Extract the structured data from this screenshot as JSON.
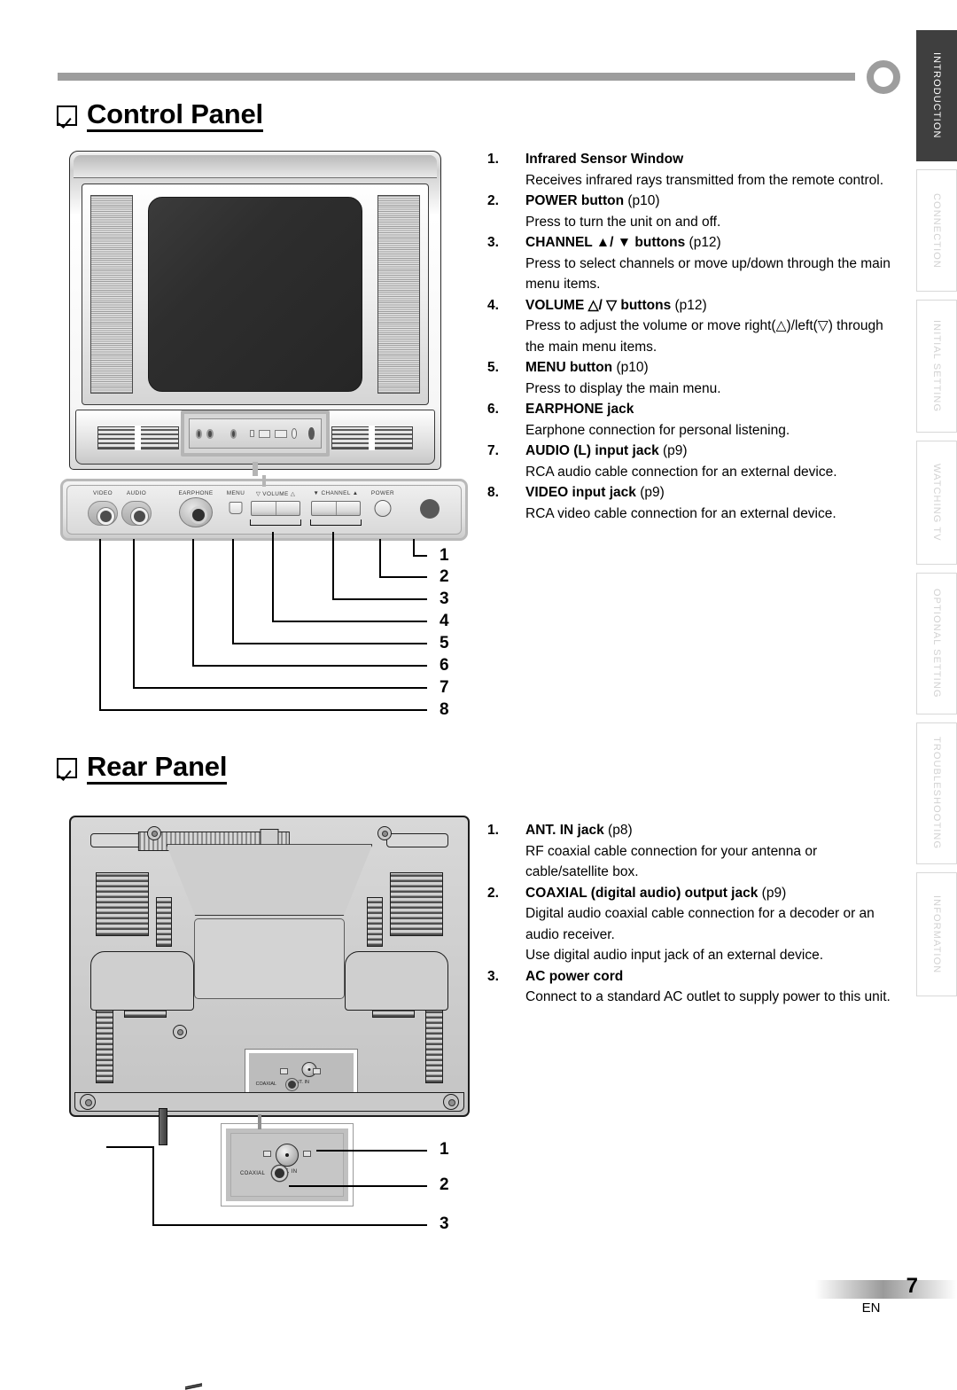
{
  "header": {
    "decor_rule": "horizontal-rule",
    "decor_ring": "ring-marker"
  },
  "sections": {
    "control_panel": {
      "heading": "Control Panel",
      "items": [
        {
          "num": "1.",
          "term": "Infrared Sensor Window",
          "page": "",
          "text": "Receives infrared rays transmitted from the remote control."
        },
        {
          "num": "2.",
          "term": "POWER button",
          "page": "(p10)",
          "text": "Press to turn the unit on and off."
        },
        {
          "num": "3.",
          "term": "CHANNEL ▲/ ▼ buttons",
          "page": "(p12)",
          "text": "Press to select channels or move up/down through the main menu items."
        },
        {
          "num": "4.",
          "term": "VOLUME △/ ▽ buttons",
          "page": "(p12)",
          "text": "Press to adjust the volume or move right(△)/left(▽) through the main menu items."
        },
        {
          "num": "5.",
          "term": "MENU button",
          "page": "(p10)",
          "text": "Press to display the main menu."
        },
        {
          "num": "6.",
          "term": "EARPHONE jack",
          "page": "",
          "text": "Earphone connection for personal listening."
        },
        {
          "num": "7.",
          "term": "AUDIO (L) input jack",
          "page": "(p9)",
          "text": "RCA audio cable connection for an external device."
        },
        {
          "num": "8.",
          "term": "VIDEO input jack",
          "page": "(p9)",
          "text": "RCA video cable connection for an external device."
        }
      ],
      "callout_numbers": [
        "1",
        "2",
        "3",
        "4",
        "5",
        "6",
        "7",
        "8"
      ],
      "panel_labels": {
        "video": "VIDEO",
        "audio": "AUDIO",
        "earphone": "EARPHONE",
        "menu": "MENU",
        "volume": "▽ VOLUME △",
        "channel": "▼ CHANNEL ▲",
        "power": "POWER"
      }
    },
    "rear_panel": {
      "heading": "Rear Panel",
      "items": [
        {
          "num": "1.",
          "term": "ANT. IN jack",
          "page": "(p8)",
          "text": "RF coaxial cable connection for your antenna or cable/satellite box."
        },
        {
          "num": "2.",
          "term": "COAXIAL (digital audio) output jack",
          "page": "(p9)",
          "text": "Digital audio coaxial cable connection for a decoder or an audio receiver.",
          "text2": "Use digital audio input jack of an external device."
        },
        {
          "num": "3.",
          "term": "AC power cord",
          "page": "",
          "text": "Connect to a standard AC outlet to supply power to this unit."
        }
      ],
      "callout_numbers": [
        "1",
        "2",
        "3"
      ],
      "panel_labels": {
        "ant_in": "ANT. IN",
        "coaxial": "COAXIAL"
      }
    }
  },
  "tabs": [
    {
      "label": "INTRODUCTION",
      "active": true
    },
    {
      "label": "CONNECTION",
      "active": false
    },
    {
      "label": "INITIAL SETTING",
      "active": false
    },
    {
      "label": "WATCHING TV",
      "active": false
    },
    {
      "label": "OPTIONAL SETTING",
      "active": false
    },
    {
      "label": "TROUBLESHOOTING",
      "active": false
    },
    {
      "label": "INFORMATION",
      "active": false
    }
  ],
  "footer": {
    "page_number": "7",
    "language": "EN"
  },
  "colors": {
    "tab_active_bg": "#3f3f3f",
    "rule": "#9d9d9d",
    "text": "#000000"
  }
}
